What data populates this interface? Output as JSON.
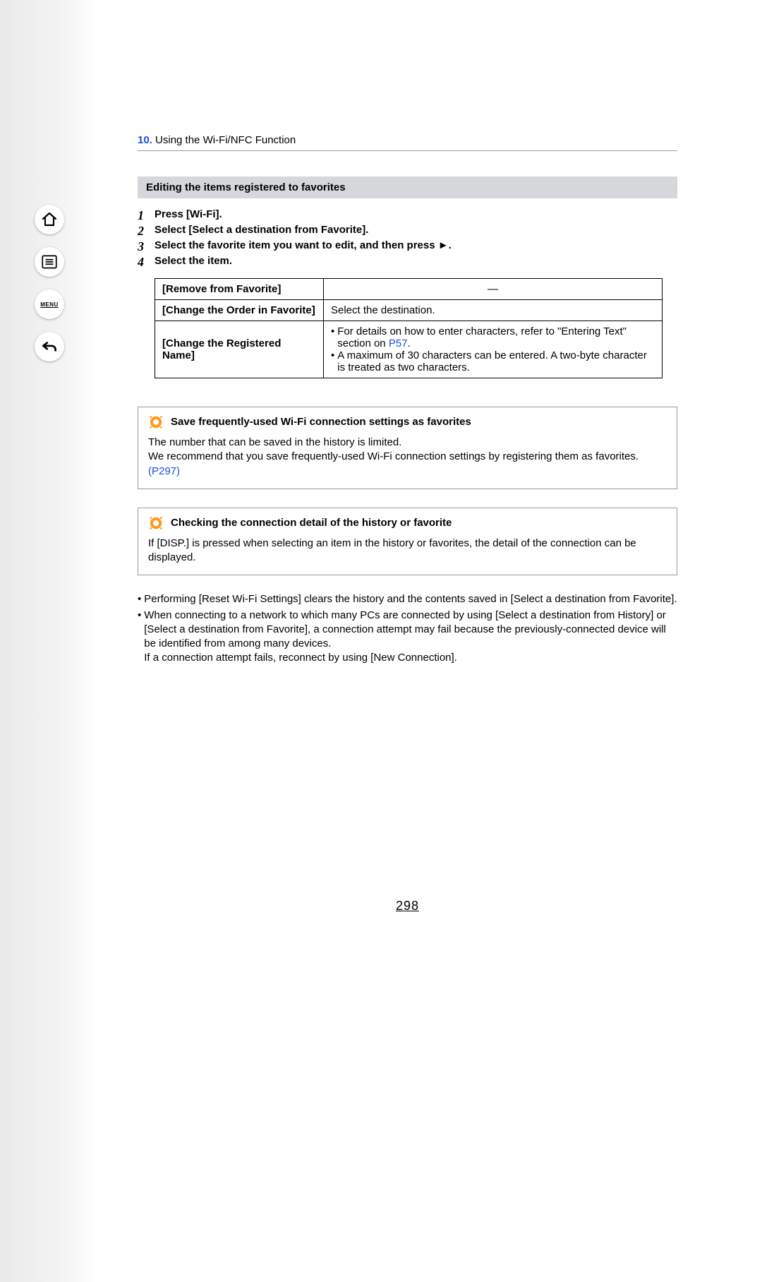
{
  "chapter": {
    "number": "10.",
    "title": "Using the Wi-Fi/NFC Function"
  },
  "sidebar": {
    "menu_label": "MENU"
  },
  "section_bar": "Editing the items registered to favorites",
  "steps": [
    {
      "n": "1",
      "text": "Press [Wi-Fi]."
    },
    {
      "n": "2",
      "text": "Select [Select a destination from Favorite]."
    },
    {
      "n": "3",
      "text": "Select the favorite item you want to edit, and then press ►."
    },
    {
      "n": "4",
      "text": "Select the item."
    }
  ],
  "table": {
    "row1_label": "[Remove from Favorite]",
    "row1_val": "—",
    "row2_label": "[Change the Order in Favorite]",
    "row2_val": "Select the destination.",
    "row3_label": "[Change the Registered Name]",
    "row3_b1a": "For details on how to enter characters, refer to \"Entering Text\" section on ",
    "row3_b1link": "P57",
    "row3_b1b": ".",
    "row3_b2": "A maximum of 30 characters can be entered. A two-byte character is treated as two characters."
  },
  "note1": {
    "title": "Save frequently-used Wi-Fi connection settings as favorites",
    "p1": "The number that can be saved in the history is limited.",
    "p2a": "We recommend that you save frequently-used Wi-Fi connection settings by registering them as favorites. ",
    "p2link": "(P297)"
  },
  "note2": {
    "title": "Checking the connection detail of the history or favorite",
    "p1": "If [DISP.] is pressed when selecting an item in the history or favorites, the detail of the connection can be displayed."
  },
  "bottom_notes": {
    "b1": "Performing [Reset Wi-Fi Settings] clears the history and the contents saved in [Select a destination from Favorite].",
    "b2": "When connecting to a network to which many PCs are connected by using [Select a destination from History] or [Select a destination from Favorite], a connection attempt may fail because the previously-connected device will be identified from among many devices.",
    "b2_2": "If a connection attempt fails, reconnect by using [New Connection]."
  },
  "page_number": "298"
}
